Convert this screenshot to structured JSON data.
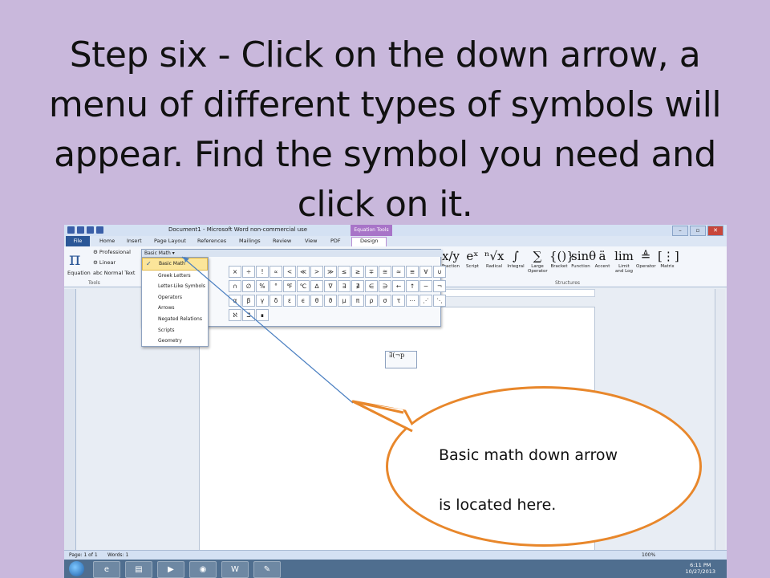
{
  "slide_title": "Step six - Click on the down arrow, a menu of different types of symbols will appear.  Find the symbol you need and click on it.",
  "callout_text": "Basic math down arrow\nis located here.",
  "callout_lines": [
    "Basic math down arrow",
    "is located here."
  ],
  "window": {
    "title": "Document1 - Microsoft Word non-commercial use",
    "contextual_tab": "Equation Tools",
    "controls": [
      "–",
      "▫",
      "✕"
    ]
  },
  "tabs": [
    "File",
    "Home",
    "Insert",
    "Page Layout",
    "References",
    "Mailings",
    "Review",
    "View",
    "PDF",
    "Design"
  ],
  "tools_group": {
    "equation_label": "Equation",
    "options": [
      "Professional",
      "Linear",
      "Normal Text"
    ],
    "label": "Tools"
  },
  "symbol_gallery": {
    "header": "Basic Math ▾",
    "symbols": [
      "×",
      "÷",
      "!",
      "∝",
      "<",
      "≪",
      ">",
      "≫",
      "≤",
      "≥",
      "∓",
      "≅",
      "≈",
      "≡",
      "∀",
      "∪",
      "∩",
      "∅",
      "%",
      "°",
      "℉",
      "℃",
      "∆",
      "∇",
      "∃",
      "∄",
      "∈",
      "∋",
      "←",
      "↑",
      "−",
      "¬",
      "α",
      "β",
      "γ",
      "δ",
      "ε",
      "ϵ",
      "θ",
      "ϑ",
      "μ",
      "π",
      "ρ",
      "σ",
      "τ",
      "⋯",
      "⋰",
      "⋱",
      "ℵ",
      "ℶ",
      "∎"
    ]
  },
  "symbol_menu": {
    "items": [
      "Basic Math",
      "Greek Letters",
      "Letter-Like Symbols",
      "Operators",
      "Arrows",
      "Negated Relations",
      "Scripts",
      "Geometry"
    ],
    "selected": "Basic Math"
  },
  "structures": {
    "items": [
      {
        "glyph": "x/y",
        "label": "Fraction"
      },
      {
        "glyph": "eˣ",
        "label": "Script"
      },
      {
        "glyph": "ⁿ√x",
        "label": "Radical"
      },
      {
        "glyph": "∫",
        "label": "Integral"
      },
      {
        "glyph": "∑",
        "label": "Large Operator"
      },
      {
        "glyph": "{()}",
        "label": "Bracket"
      },
      {
        "glyph": "sinθ",
        "label": "Function"
      },
      {
        "glyph": "ä",
        "label": "Accent"
      },
      {
        "glyph": "lim",
        "label": "Limit and Log"
      },
      {
        "glyph": "≜",
        "label": "Operator"
      },
      {
        "glyph": "[⋮]",
        "label": "Matrix"
      }
    ],
    "label": "Structures"
  },
  "equation_content": "∃(¬p",
  "status": {
    "page": "Page: 1 of 1",
    "words": "Words: 1",
    "zoom": "100%"
  },
  "clock": {
    "time": "6:11 PM",
    "date": "10/27/2013"
  },
  "colors": {
    "background": "#c9b8dc",
    "callout_border": "#e8872b",
    "arrow_line": "#4a7fc1",
    "file_tab": "#2b5797",
    "equation_tools": "#a874c8"
  }
}
